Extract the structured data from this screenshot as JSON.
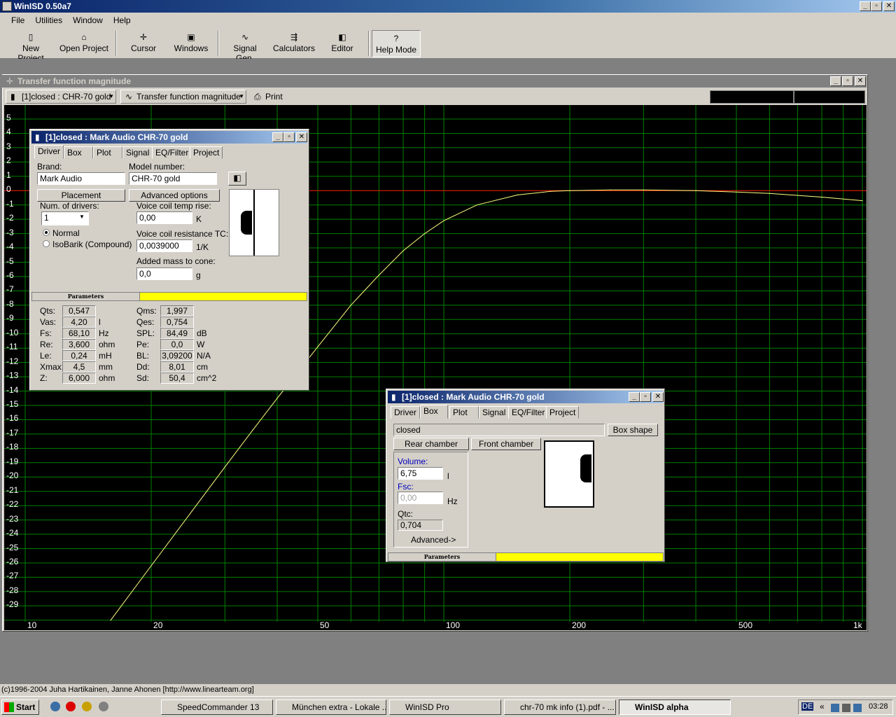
{
  "app": {
    "title": "WinISD 0.50a7",
    "controls": [
      "_",
      "▫",
      "✕"
    ]
  },
  "menu": [
    "File",
    "Utilities",
    "Window",
    "Help"
  ],
  "toolbar": {
    "new_project": "New Project",
    "open_project": "Open Project",
    "cursor": "Cursor",
    "windows": "Windows",
    "signal_gen": "Signal Gen.",
    "calculators": "Calculators",
    "editor": "Editor",
    "help_mode": "Help Mode"
  },
  "plot_window": {
    "title": "Transfer function magnitude",
    "project_combo": "[1]closed : CHR-70 gold",
    "graph_combo": "Transfer function magnitude",
    "print": "Print"
  },
  "chart_data": {
    "type": "line",
    "x_scale": "log",
    "xlim": [
      10,
      1000
    ],
    "ylim": [
      -30,
      5
    ],
    "x_tick_labels": [
      "10",
      "20",
      "50",
      "100",
      "200",
      "500",
      "1k"
    ],
    "x_tick_values": [
      10,
      20,
      50,
      100,
      200,
      500,
      1000
    ],
    "y_tick_labels": [
      "5",
      "4",
      "3",
      "2",
      "1",
      "0",
      "-1",
      "-2",
      "-3",
      "-4",
      "-5",
      "-6",
      "-7",
      "-8",
      "-9",
      "-10",
      "-11",
      "-12",
      "-13",
      "-14",
      "-15",
      "-16",
      "-17",
      "-18",
      "-19",
      "-20",
      "-21",
      "-22",
      "-23",
      "-24",
      "-25",
      "-26",
      "-27",
      "-28",
      "-29"
    ],
    "grid": true,
    "reference_line_y": 0,
    "colors": {
      "background": "#000000",
      "grid": "#008000",
      "curve": "#ffff80",
      "reference": "#ff0000",
      "labels": "#ffffff"
    },
    "series": [
      {
        "x": [
          16,
          20,
          25,
          30,
          35,
          40,
          45,
          50,
          60,
          70,
          80,
          90,
          100,
          120,
          150,
          180,
          200,
          250,
          300,
          400,
          500,
          600,
          800,
          1000
        ],
        "y": [
          -30,
          -26.2,
          -22.4,
          -19.3,
          -16.7,
          -14.5,
          -12.6,
          -10.9,
          -8.0,
          -5.9,
          -4.2,
          -3.0,
          -2.1,
          -1.0,
          -0.3,
          -0.05,
          0.0,
          0.05,
          0.05,
          0.0,
          -0.1,
          -0.2,
          -0.45,
          -0.7
        ]
      }
    ]
  },
  "driver_window": {
    "title": "[1]closed : Mark Audio CHR-70 gold",
    "tabs": [
      "Driver",
      "Box",
      "Plot",
      "Signal",
      "EQ/Filter",
      "Project"
    ],
    "brand_label": "Brand:",
    "brand": "Mark Audio",
    "model_label": "Model number:",
    "model": "CHR-70 gold",
    "placement": "Placement",
    "advanced": "Advanced options",
    "num_drivers_label": "Num. of drivers:",
    "num_drivers": "1",
    "radio_normal": "Normal",
    "radio_isobarik": "IsoBarik (Compound)",
    "vc_temp_label": "Voice coil temp rise:",
    "vc_temp": "0,00",
    "vc_temp_unit": "K",
    "vc_tc_label": "Voice coil resistance TC:",
    "vc_tc": "0,0039000",
    "vc_tc_unit": "1/K",
    "added_mass_label": "Added mass to cone:",
    "added_mass": "0,0",
    "added_mass_unit": "g",
    "params_label": "Parameters",
    "params_left": [
      {
        "name": "Qts:",
        "value": "0,547",
        "unit": ""
      },
      {
        "name": "Vas:",
        "value": "4,20",
        "unit": "l"
      },
      {
        "name": "Fs:",
        "value": "68,10",
        "unit": "Hz"
      },
      {
        "name": "Re:",
        "value": "3,600",
        "unit": "ohm"
      },
      {
        "name": "Le:",
        "value": "0,24",
        "unit": "mH"
      },
      {
        "name": "Xmax:",
        "value": "4,5",
        "unit": "mm"
      },
      {
        "name": "Z:",
        "value": "6,000",
        "unit": "ohm"
      }
    ],
    "params_right": [
      {
        "name": "Qms:",
        "value": "1,997",
        "unit": ""
      },
      {
        "name": "Qes:",
        "value": "0,754",
        "unit": ""
      },
      {
        "name": "SPL:",
        "value": "84,49",
        "unit": "dB"
      },
      {
        "name": "Pe:",
        "value": "0,0",
        "unit": "W"
      },
      {
        "name": "BL:",
        "value": "3,09200",
        "unit": "N/A"
      },
      {
        "name": "Dd:",
        "value": "8,01",
        "unit": "cm"
      },
      {
        "name": "Sd:",
        "value": "50,4",
        "unit": "cm^2"
      }
    ]
  },
  "box_window": {
    "title": "[1]closed : Mark Audio CHR-70 gold",
    "tabs": [
      "Driver",
      "Box",
      "Plot",
      "Signal",
      "EQ/Filter",
      "Project"
    ],
    "box_type": "closed",
    "box_shape": "Box shape",
    "rear_chamber": "Rear chamber",
    "front_chamber": "Front chamber",
    "volume_label": "Volume:",
    "volume": "6,75",
    "volume_unit": "l",
    "fsc_label": "Fsc:",
    "fsc": "0,00",
    "fsc_unit": "Hz",
    "qtc_label": "Qtc:",
    "qtc": "0,704",
    "advanced": "Advanced->",
    "params_label": "Parameters"
  },
  "status": "(c)1996-2004 Juha Hartikainen, Janne Ahonen [http://www.linearteam.org]",
  "taskbar": {
    "start": "Start",
    "tasks": [
      "SpeedCommander 13",
      "München extra - Lokale ...",
      "WinISD Pro",
      "chr-70 mk info (1).pdf - ...",
      "WinISD alpha"
    ],
    "lang": "DE",
    "time": "03:28"
  }
}
